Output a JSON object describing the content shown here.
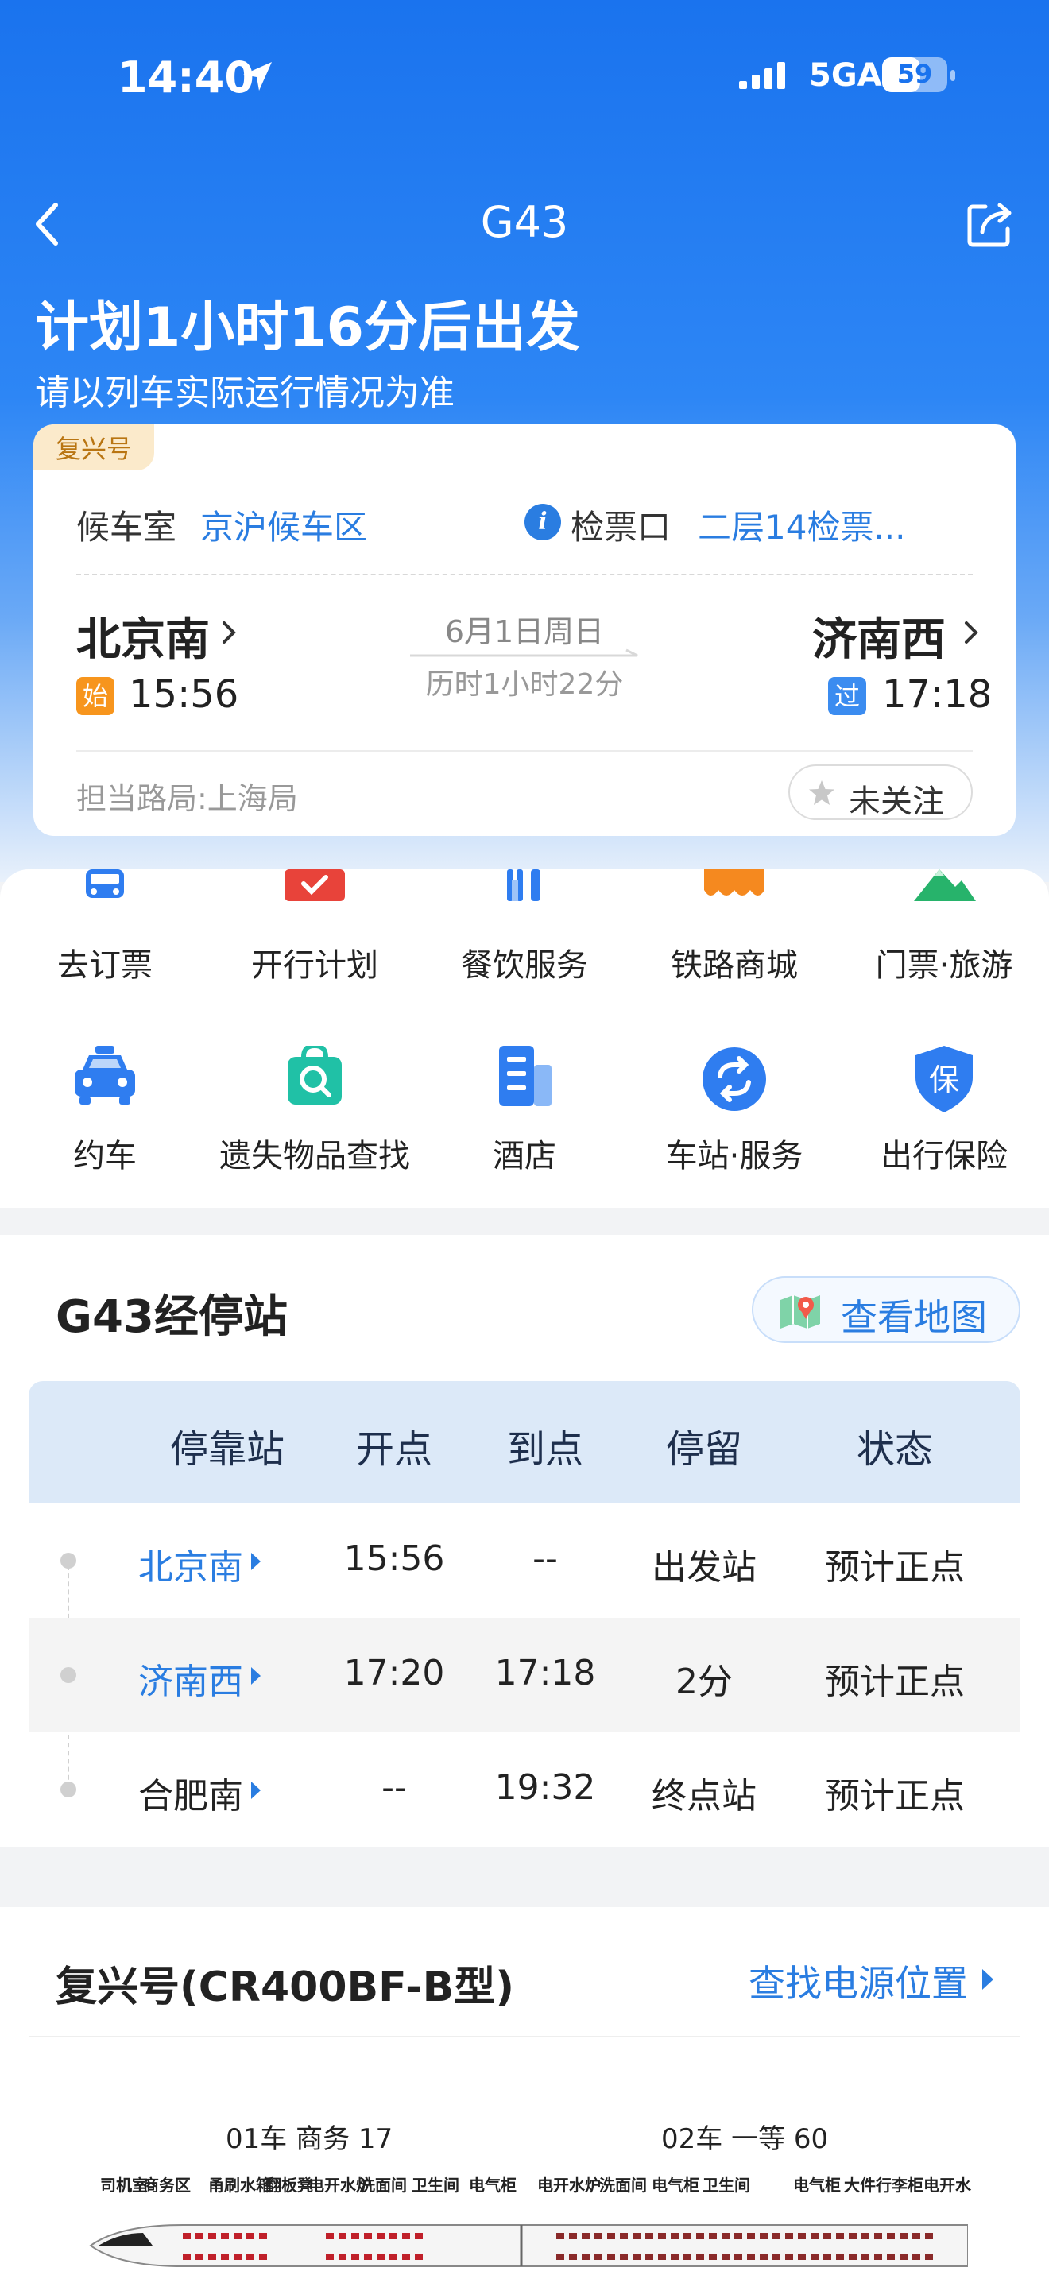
{
  "status_bar": {
    "time": "14:40",
    "network": "5GA",
    "battery": "59",
    "battery_level": 0.59
  },
  "nav": {
    "title": "G43",
    "back_icon": "chevron-left-icon",
    "share_icon": "share-icon"
  },
  "hero": {
    "title": "计划1小时16分后出发",
    "subtitle": "请以列车实际运行情况为准"
  },
  "trip_card": {
    "brand_tag": "复兴号",
    "waiting_room_label": "候车室",
    "waiting_room_value": "京沪候车区",
    "ticket_gate_label": "检票口",
    "ticket_gate_value": "二层14检票...",
    "from_station": "北京南",
    "from_badge": "始",
    "from_time": "15:56",
    "date": "6月1日周日",
    "duration": "历时1小时22分",
    "to_station": "济南西",
    "to_badge": "过",
    "to_time": "17:18",
    "bureau": "担当路局:上海局",
    "follow_label": "未关注"
  },
  "services": [
    {
      "label": "去订票",
      "icon": "train-ticket-icon",
      "color": "#2f7df0"
    },
    {
      "label": "开行计划",
      "icon": "calendar-check-icon",
      "color": "#e8433a"
    },
    {
      "label": "餐饮服务",
      "icon": "fork-knife-icon",
      "color": "#2f7df0"
    },
    {
      "label": "铁路商城",
      "icon": "shop-icon",
      "color": "#f5891f"
    },
    {
      "label": "门票·旅游",
      "icon": "mountain-icon",
      "color": "#27b36b"
    },
    {
      "label": "约车",
      "icon": "taxi-icon",
      "color": "#2f7df0"
    },
    {
      "label": "遗失物品查找",
      "icon": "lost-found-search-icon",
      "color": "#20c1a6"
    },
    {
      "label": "酒店",
      "icon": "hotel-building-icon",
      "color": "#2f7df0"
    },
    {
      "label": "车站·服务",
      "icon": "station-service-icon",
      "color": "#2f7df0"
    },
    {
      "label": "出行保险",
      "icon": "insurance-shield-icon",
      "color": "#2f7df0"
    }
  ],
  "stops": {
    "title": "G43经停站",
    "map_button": "查看地图",
    "headers": [
      "停靠站",
      "开点",
      "到点",
      "停留",
      "状态"
    ],
    "rows": [
      {
        "station": "北京南",
        "depart": "15:56",
        "arrive": "--",
        "stay": "出发站",
        "status": "预计正点",
        "highlight": true
      },
      {
        "station": "济南西",
        "depart": "17:20",
        "arrive": "17:18",
        "stay": "2分",
        "status": "预计正点",
        "highlight": true
      },
      {
        "station": "合肥南",
        "depart": "--",
        "arrive": "19:32",
        "stay": "终点站",
        "status": "预计正点",
        "highlight": false
      }
    ]
  },
  "train": {
    "title": "复兴号(CR400BF-B型)",
    "power_link": "查找电源位置",
    "car1_label": "01车 商务 17",
    "car2_label": "02车 一等 60",
    "car1_features": [
      "司机室",
      "商务区",
      "甬刷水箱",
      "翻板凳",
      "电开水炉",
      "洗面间",
      "卫生间",
      "电气柜"
    ],
    "car2_features": [
      "电开水炉",
      "洗面间",
      "电气柜",
      "卫生间",
      "电气柜",
      "大件行李柜",
      "电开水"
    ]
  }
}
